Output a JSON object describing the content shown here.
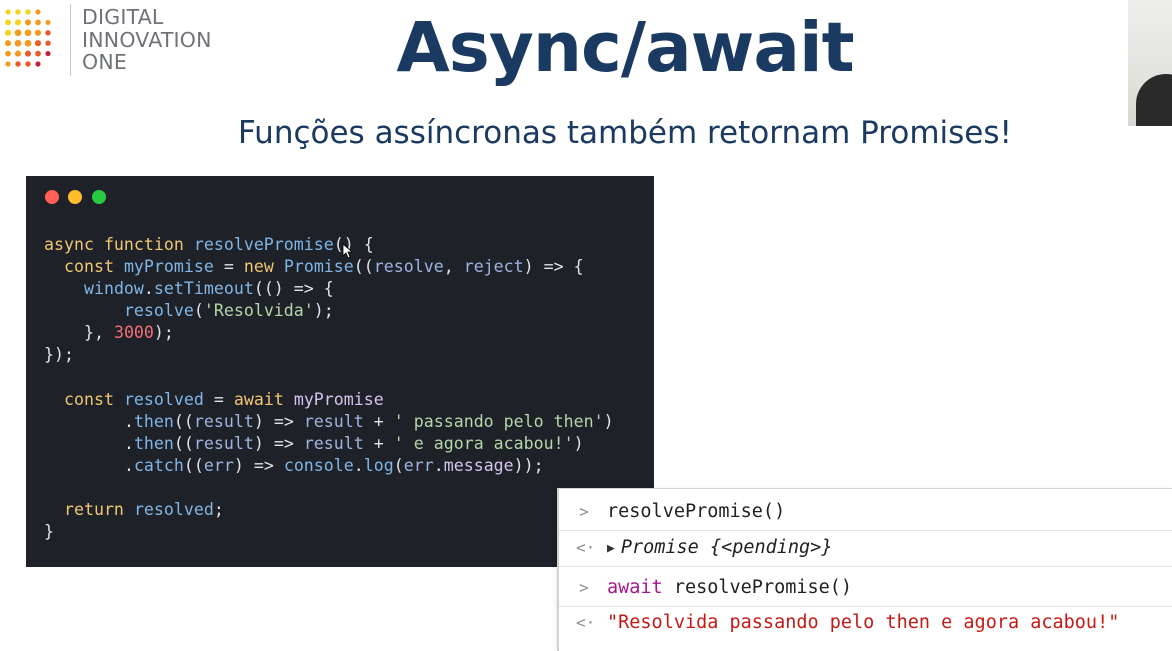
{
  "logo": {
    "lines": [
      "DIGITAL",
      "INNOVATION",
      "ONE"
    ],
    "icon": "dots-logo-icon",
    "dot_colors": [
      "#f7d21a",
      "#f39a1e",
      "#ea5a2a",
      "#c21f3a"
    ]
  },
  "slide": {
    "title": "Async/await",
    "subtitle": "Funções assíncronas também retornam Promises!"
  },
  "code_window": {
    "buttons": [
      "close",
      "minimize",
      "maximize"
    ],
    "colors": {
      "red": "#ff5f56",
      "yellow": "#ffbd2e",
      "green": "#27c93f",
      "background": "#1e2128"
    },
    "lines": [
      "async function resolvePromise() {",
      "  const myPromise = new Promise((resolve, reject) => {",
      "    window.setTimeout(() => {",
      "        resolve('Resolvida');",
      "    }, 3000);",
      "});",
      "",
      "  const resolved = await myPromise",
      "        .then((result) => result + ' passando pelo then')",
      "        .then((result) => result + ' e agora acabou!')",
      "        .catch((err) => console.log(err.message));",
      "",
      "  return resolved;",
      "}"
    ]
  },
  "console": {
    "rows": [
      {
        "type": "input",
        "marker": ">",
        "text": "resolvePromise()"
      },
      {
        "type": "output",
        "marker": "<·",
        "object_label": "Promise",
        "object_state": "{<pending>}"
      },
      {
        "type": "input",
        "marker": ">",
        "keyword": "await",
        "text": " resolvePromise()"
      },
      {
        "type": "output",
        "marker": "<·",
        "string": "\"Resolvida passando pelo then e agora acabou!\""
      }
    ],
    "colors": {
      "keyword": "#a8168e",
      "string": "#c41a16"
    }
  }
}
